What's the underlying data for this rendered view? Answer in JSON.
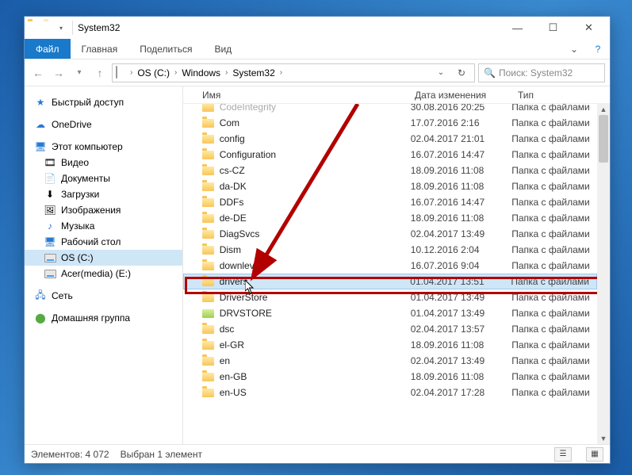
{
  "title": "System32",
  "ribbon": {
    "file": "Файл",
    "home": "Главная",
    "share": "Поделиться",
    "view": "Вид"
  },
  "breadcrumbs": [
    "OS (C:)",
    "Windows",
    "System32"
  ],
  "search_placeholder": "Поиск: System32",
  "sidebar": {
    "quick": "Быстрый доступ",
    "onedrive": "OneDrive",
    "thispc": "Этот компьютер",
    "video": "Видео",
    "docs": "Документы",
    "downloads": "Загрузки",
    "images": "Изображения",
    "music": "Музыка",
    "desktop": "Рабочий стол",
    "osc": "OS (C:)",
    "acer": "Acer(media) (E:)",
    "network": "Сеть",
    "homegroup": "Домашняя группа"
  },
  "columns": {
    "name": "Имя",
    "date": "Дата изменения",
    "type": "Тип"
  },
  "type_label": "Папка с файлами",
  "rows": [
    {
      "name": "CodeIntegrity",
      "date": "30.08.2016 20:25",
      "seed": false
    },
    {
      "name": "Com",
      "date": "17.07.2016 2:16",
      "seed": false
    },
    {
      "name": "config",
      "date": "02.04.2017 21:01",
      "seed": false
    },
    {
      "name": "Configuration",
      "date": "16.07.2016 14:47",
      "seed": false
    },
    {
      "name": "cs-CZ",
      "date": "18.09.2016 11:08",
      "seed": false
    },
    {
      "name": "da-DK",
      "date": "18.09.2016 11:08",
      "seed": false
    },
    {
      "name": "DDFs",
      "date": "16.07.2016 14:47",
      "seed": false
    },
    {
      "name": "de-DE",
      "date": "18.09.2016 11:08",
      "seed": false
    },
    {
      "name": "DiagSvcs",
      "date": "02.04.2017 13:49",
      "seed": false
    },
    {
      "name": "Dism",
      "date": "10.12.2016 2:04",
      "seed": false
    },
    {
      "name": "downlevel",
      "date": "16.07.2016 9:04",
      "seed": false
    },
    {
      "name": "drivers",
      "date": "01.04.2017 13:51",
      "seed": false,
      "selected": true
    },
    {
      "name": "DriverStore",
      "date": "01.04.2017 13:49",
      "seed": false
    },
    {
      "name": "DRVSTORE",
      "date": "01.04.2017 13:49",
      "seed": true
    },
    {
      "name": "dsc",
      "date": "02.04.2017 13:57",
      "seed": false
    },
    {
      "name": "el-GR",
      "date": "18.09.2016 11:08",
      "seed": false
    },
    {
      "name": "en",
      "date": "02.04.2017 13:49",
      "seed": false
    },
    {
      "name": "en-GB",
      "date": "18.09.2016 11:08",
      "seed": false
    },
    {
      "name": "en-US",
      "date": "02.04.2017 17:28",
      "seed": false
    }
  ],
  "status": {
    "items": "Элементов: 4 072",
    "selected": "Выбран 1 элемент"
  }
}
